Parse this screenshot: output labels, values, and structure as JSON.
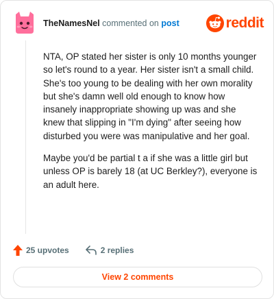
{
  "header": {
    "username": "TheNamesNel",
    "action_text": "commented on",
    "post_link": "post",
    "brand": "reddit"
  },
  "comment": {
    "paragraphs": [
      "NTA, OP stated her sister is only 10 months younger so let's round to a year. Her sister isn't a small child. She's too young to be dealing with her own morality but she's damn well old enough to know how insanely inappropriate showing up was and she knew that slipping in \"I'm dying\" after seeing how disturbed you were was manipulative and her goal.",
      "Maybe you'd be partial t a if she was a little girl but unless OP is barely 18 (at UC Berkley?), everyone is an adult here."
    ]
  },
  "actions": {
    "upvotes": "25 upvotes",
    "replies": "2 replies"
  },
  "view_button": "View 2 comments",
  "colors": {
    "accent": "#ff4500",
    "link": "#0079d3",
    "avatar": "#ff6f9c"
  },
  "icons": {
    "avatar": "snoo-avatar-icon",
    "brand": "reddit-logo-icon",
    "upvote": "upvote-arrow-icon",
    "reply": "reply-arrow-icon"
  }
}
